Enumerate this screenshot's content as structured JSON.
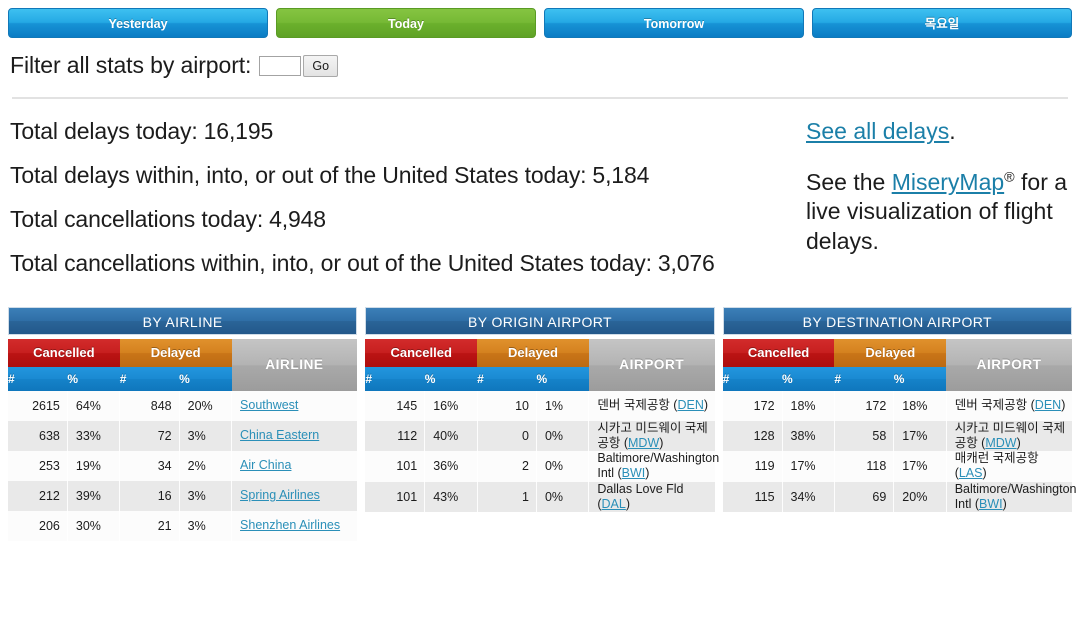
{
  "tabs": [
    {
      "label": "Yesterday",
      "style": "blue"
    },
    {
      "label": "Today",
      "style": "green"
    },
    {
      "label": "Tomorrow",
      "style": "blue"
    },
    {
      "label": "목요일",
      "style": "blue"
    }
  ],
  "filter": {
    "label": "Filter all stats by airport:",
    "input_value": "",
    "placeholder": "",
    "go_label": "Go"
  },
  "stats": {
    "total_delays_label": "Total delays today:",
    "total_delays_value": "16,195",
    "us_delays_label": "Total delays within, into, or out of the United States today:",
    "us_delays_value": "5,184",
    "total_cancellations_label": "Total cancellations today:",
    "total_cancellations_value": "4,948",
    "us_cancellations_label": "Total cancellations within, into, or out of the United States today:",
    "us_cancellations_value": "3,076"
  },
  "sidebar": {
    "see_all_delays_link": "See all delays",
    "see_all_delays_period": ".",
    "misery_prefix": "See the ",
    "misery_link": "MiseryMap",
    "misery_reg": "®",
    "misery_suffix": " for a live visualization of flight delays."
  },
  "colors": {
    "tab_blue": "#1793d6",
    "tab_green": "#6bb02c",
    "panel_title": "#2a6498",
    "cancelled": "#c71f1f",
    "delayed": "#d4811f",
    "subheader_blue": "#1582c9",
    "name_header_gray": "#a9a9a9",
    "link": "#2a8fb8"
  },
  "tables": [
    {
      "title": "BY AIRLINE",
      "group_headers": {
        "cancelled": "Cancelled",
        "delayed": "Delayed",
        "name": "AIRLINE"
      },
      "sub_headers": {
        "cancel_num": "#",
        "cancel_pct": "%",
        "delay_num": "#",
        "delay_pct": "%"
      },
      "rows": [
        {
          "cancel_num": "2615",
          "cancel_pct": "64%",
          "delay_num": "848",
          "delay_pct": "20%",
          "name": "Southwest",
          "name_is_link": true
        },
        {
          "cancel_num": "638",
          "cancel_pct": "33%",
          "delay_num": "72",
          "delay_pct": "3%",
          "name": "China Eastern",
          "name_is_link": true
        },
        {
          "cancel_num": "253",
          "cancel_pct": "19%",
          "delay_num": "34",
          "delay_pct": "2%",
          "name": "Air China",
          "name_is_link": true
        },
        {
          "cancel_num": "212",
          "cancel_pct": "39%",
          "delay_num": "16",
          "delay_pct": "3%",
          "name": "Spring Airlines",
          "name_is_link": true
        },
        {
          "cancel_num": "206",
          "cancel_pct": "30%",
          "delay_num": "21",
          "delay_pct": "3%",
          "name": "Shenzhen Airlines",
          "name_is_link": true
        }
      ]
    },
    {
      "title": "BY ORIGIN AIRPORT",
      "group_headers": {
        "cancelled": "Cancelled",
        "delayed": "Delayed",
        "name": "AIRPORT"
      },
      "sub_headers": {
        "cancel_num": "#",
        "cancel_pct": "%",
        "delay_num": "#",
        "delay_pct": "%"
      },
      "rows": [
        {
          "cancel_num": "145",
          "cancel_pct": "16%",
          "delay_num": "10",
          "delay_pct": "1%",
          "name": "덴버 국제공항 (",
          "code": "DEN",
          "name_tail": ")"
        },
        {
          "cancel_num": "112",
          "cancel_pct": "40%",
          "delay_num": "0",
          "delay_pct": "0%",
          "name": "시카고 미드웨이 국제공항 (",
          "code": "MDW",
          "name_tail": ")"
        },
        {
          "cancel_num": "101",
          "cancel_pct": "36%",
          "delay_num": "2",
          "delay_pct": "0%",
          "name": "Baltimore/Washington Intl (",
          "code": "BWI",
          "name_tail": ")"
        },
        {
          "cancel_num": "101",
          "cancel_pct": "43%",
          "delay_num": "1",
          "delay_pct": "0%",
          "name": "Dallas Love Fld (",
          "code": "DAL",
          "name_tail": ")"
        }
      ]
    },
    {
      "title": "BY DESTINATION AIRPORT",
      "group_headers": {
        "cancelled": "Cancelled",
        "delayed": "Delayed",
        "name": "AIRPORT"
      },
      "sub_headers": {
        "cancel_num": "#",
        "cancel_pct": "%",
        "delay_num": "#",
        "delay_pct": "%"
      },
      "rows": [
        {
          "cancel_num": "172",
          "cancel_pct": "18%",
          "delay_num": "172",
          "delay_pct": "18%",
          "name": "덴버 국제공항 (",
          "code": "DEN",
          "name_tail": ")"
        },
        {
          "cancel_num": "128",
          "cancel_pct": "38%",
          "delay_num": "58",
          "delay_pct": "17%",
          "name": "시카고 미드웨이 국제공항 (",
          "code": "MDW",
          "name_tail": ")"
        },
        {
          "cancel_num": "119",
          "cancel_pct": "17%",
          "delay_num": "118",
          "delay_pct": "17%",
          "name": "매캐런 국제공항 (",
          "code": "LAS",
          "name_tail": ")"
        },
        {
          "cancel_num": "115",
          "cancel_pct": "34%",
          "delay_num": "69",
          "delay_pct": "20%",
          "name": "Baltimore/Washington Intl (",
          "code": "BWI",
          "name_tail": ")"
        }
      ]
    }
  ]
}
